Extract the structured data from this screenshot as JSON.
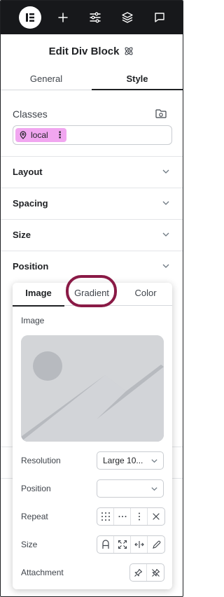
{
  "header": {
    "title": "Edit Div Block"
  },
  "tabs": [
    {
      "label": "General"
    },
    {
      "label": "Style"
    }
  ],
  "classes": {
    "label": "Classes",
    "chips": [
      {
        "label": "local"
      }
    ]
  },
  "sections": [
    {
      "label": "Layout"
    },
    {
      "label": "Spacing"
    },
    {
      "label": "Size"
    },
    {
      "label": "Position"
    }
  ],
  "background_popover": {
    "tabs": [
      {
        "label": "Image"
      },
      {
        "label": "Gradient"
      },
      {
        "label": "Color"
      }
    ],
    "image_label": "Image",
    "resolution": {
      "label": "Resolution",
      "value": "Large 10..."
    },
    "position": {
      "label": "Position",
      "value": ""
    },
    "repeat": {
      "label": "Repeat"
    },
    "size": {
      "label": "Size"
    },
    "attachment": {
      "label": "Attachment"
    }
  },
  "colors": {
    "toolbar": "#17181b",
    "chip": "#f1a6f0",
    "highlight_ring": "#8a1a46",
    "placeholder": "#d3d5d8"
  }
}
